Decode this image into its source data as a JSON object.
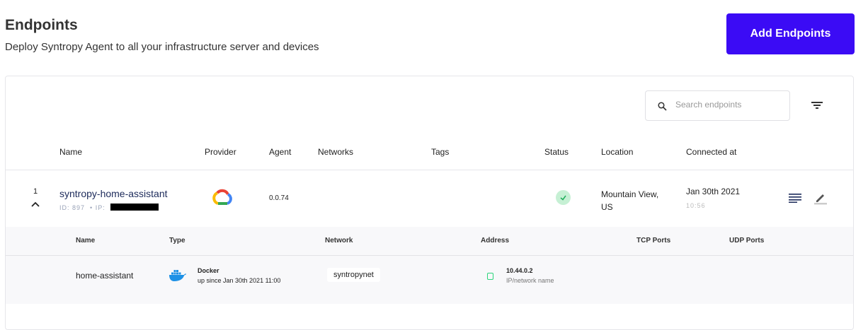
{
  "header": {
    "title": "Endpoints",
    "subtitle": "Deploy Syntropy Agent to all your infrastructure server and devices",
    "add_button": "Add Endpoints"
  },
  "search": {
    "placeholder": "Search endpoints"
  },
  "columns": [
    "Name",
    "Provider",
    "Agent",
    "Networks",
    "Tags",
    "Status",
    "Location",
    "Connected at"
  ],
  "endpoint": {
    "index": "1",
    "name": "syntropy-home-assistant",
    "id": "ID: 897",
    "ip_label": "IP:",
    "provider": "google-cloud-icon",
    "agent": "0.0.74",
    "status": "connected",
    "location_line1": "Mountain View,",
    "location_line2": "US",
    "connected_date": "Jan 30th 2021",
    "connected_time": "10:56"
  },
  "services": {
    "columns": [
      "Name",
      "Type",
      "Network",
      "Address",
      "TCP Ports",
      "UDP Ports"
    ],
    "rows": [
      {
        "name": "home-assistant",
        "type": "Docker",
        "uptime": "up since Jan 30th 2021 11:00",
        "network": "syntropynet",
        "address": "10.44.0.2",
        "address_sub": "IP/network name"
      }
    ]
  },
  "colors": {
    "accent": "#3b0bf5",
    "status_ok": "#c6f0d4"
  }
}
